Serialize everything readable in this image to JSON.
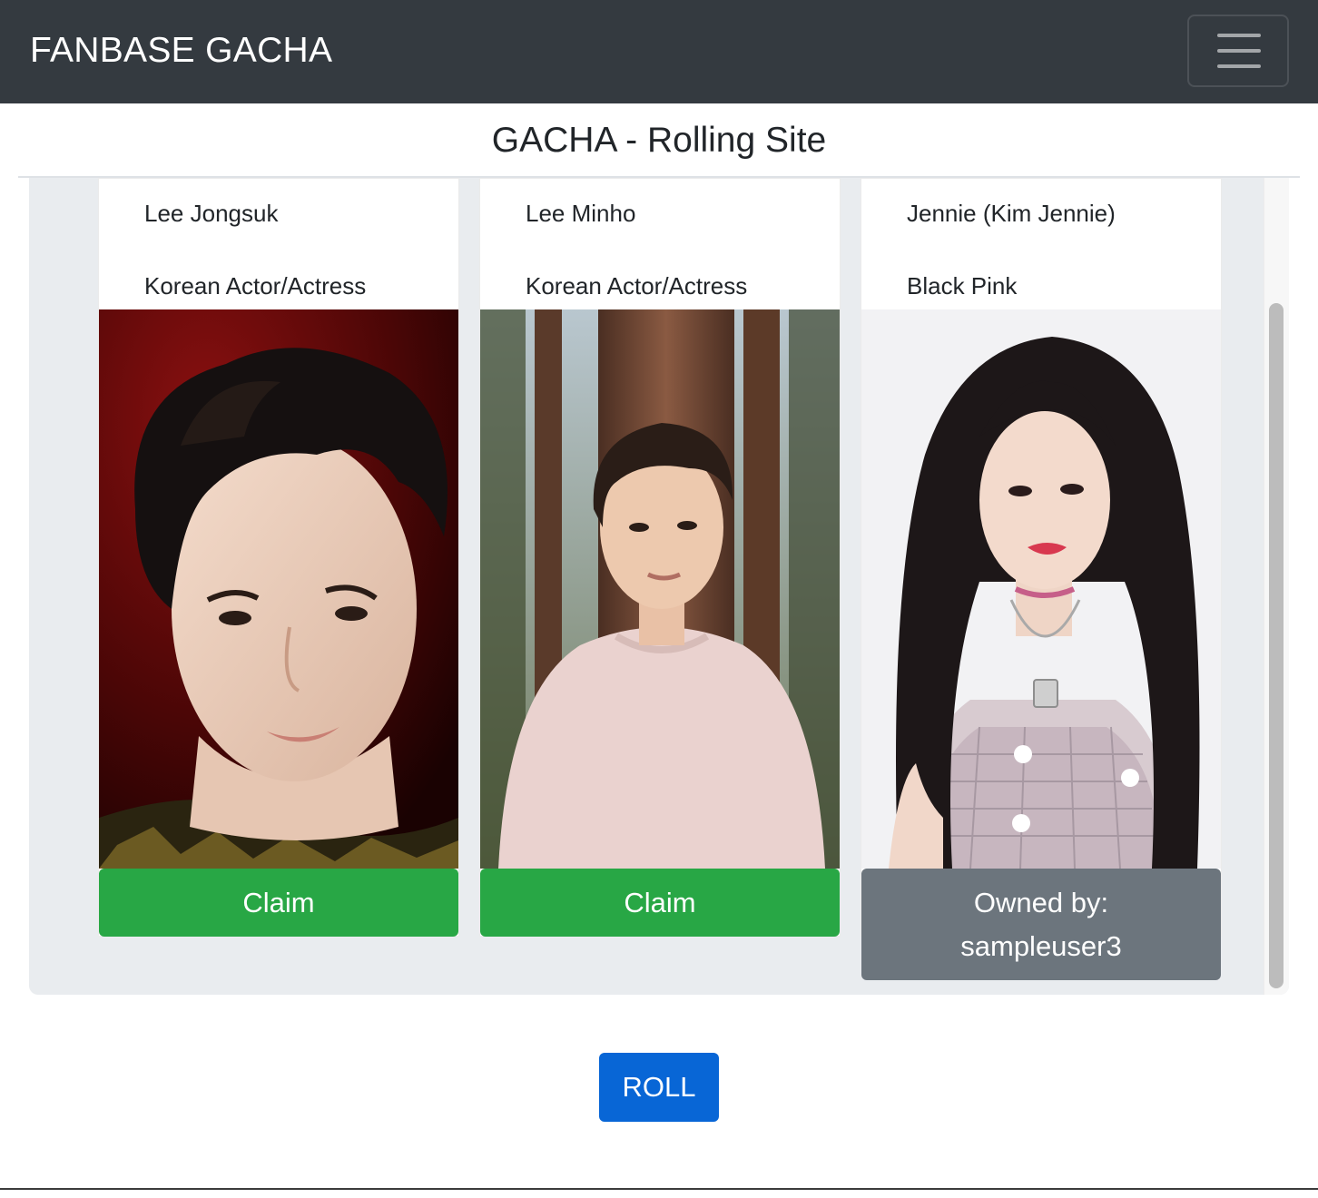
{
  "navbar": {
    "brand": "FANBASE GACHA",
    "toggler_icon": "hamburger-menu-icon"
  },
  "page": {
    "title": "GACHA - Rolling Site"
  },
  "cards": [
    {
      "name": "Lee Jongsuk",
      "group": "Korean Actor/Actress",
      "action": "Claim"
    },
    {
      "name": "Lee Minho",
      "group": "Korean Actor/Actress",
      "action": "Claim"
    },
    {
      "name": "Jennie (Kim Jennie)",
      "group": "Black Pink",
      "owned_label": "Owned by:",
      "owner": "sampleuser3"
    }
  ],
  "roll_button": "ROLL",
  "colors": {
    "navbar": "#343a40",
    "claim": "#28a745",
    "owned": "#6c757d",
    "roll": "#0866d6",
    "panel": "#e9ecef"
  }
}
